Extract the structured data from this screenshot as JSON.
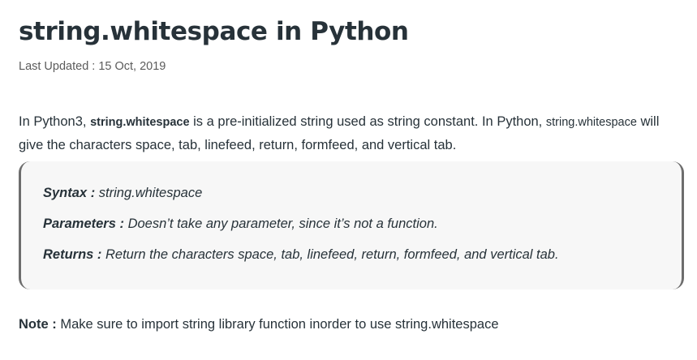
{
  "article": {
    "title": "string.whitespace in Python",
    "last_updated": "Last Updated : 15 Oct, 2019",
    "intro": {
      "part1": "In Python3, ",
      "keyword_bold": "string.whitespace",
      "part2": " is a pre-initialized string used as string constant. In Python, ",
      "keyword_plain": "string.whitespace",
      "part3": " will give the characters space, tab, linefeed, return, formfeed, and vertical tab."
    },
    "blockquote": {
      "syntax_label": "Syntax :",
      "syntax_value": " string.whitespace",
      "parameters_label": "Parameters :",
      "parameters_value": " Doesn’t take any parameter, since it’s not a function.",
      "returns_label": "Returns :",
      "returns_value": " Return the characters space, tab, linefeed, return, formfeed, and vertical tab."
    },
    "note": {
      "label": "Note :",
      "text": " Make sure to import string library function inorder to use string.whitespace"
    }
  },
  "colors": {
    "text": "#273239",
    "muted": "#5b5b5b",
    "quote_bg": "#f7f7f7",
    "quote_border": "#6d6d6d"
  }
}
